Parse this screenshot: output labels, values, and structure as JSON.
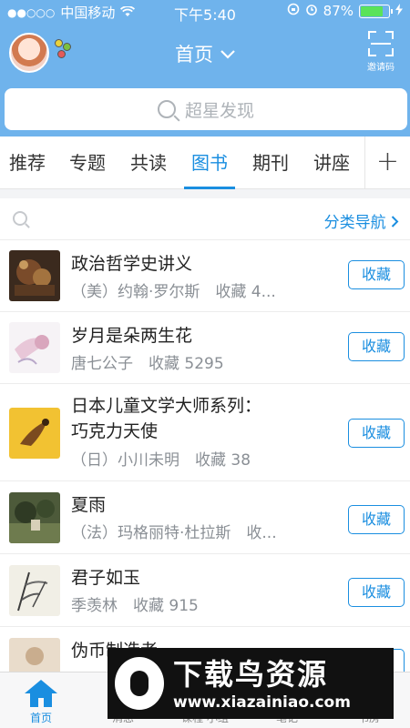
{
  "status_bar": {
    "signal_dots": "●●○○○",
    "carrier": "中国移动",
    "wifi": "wifi-icon",
    "time": "下午5:40",
    "battery_percent": "87%",
    "battery_level": 0.87
  },
  "header": {
    "title": "首页",
    "invite_label": "邀请码"
  },
  "search": {
    "placeholder": "超星发现"
  },
  "tabs": [
    {
      "label": "推荐",
      "active": false
    },
    {
      "label": "专题",
      "active": false
    },
    {
      "label": "共读",
      "active": false
    },
    {
      "label": "图书",
      "active": true
    },
    {
      "label": "期刊",
      "active": false
    },
    {
      "label": "讲座",
      "active": false
    }
  ],
  "add_tab_label": "+",
  "filter": {
    "category_nav": "分类导航"
  },
  "books": [
    {
      "title": "政治哲学史讲义",
      "meta": "（美）约翰·罗尔斯　收藏 4...",
      "button": "收藏"
    },
    {
      "title": "岁月是朵两生花",
      "meta": "唐七公子　收藏 5295",
      "button": "收藏"
    },
    {
      "title": "日本儿童文学大师系列：",
      "title2": "巧克力天使",
      "meta": "（日）小川未明　收藏 38",
      "button": "收藏"
    },
    {
      "title": "夏雨",
      "meta": "（法）玛格丽特·杜拉斯　收...",
      "button": "收藏"
    },
    {
      "title": "君子如玉",
      "meta": "季羡林　收藏 915",
      "button": "收藏"
    },
    {
      "title": "伪币制造者",
      "meta": "",
      "button": "收藏"
    }
  ],
  "bottom_tabs": [
    {
      "label": "首页",
      "active": true
    },
    {
      "label": "消息",
      "active": false
    },
    {
      "label": "课程·小组",
      "active": false
    },
    {
      "label": "笔记",
      "active": false
    },
    {
      "label": "书房",
      "active": false
    }
  ],
  "watermark": {
    "title": "下载鸟资源",
    "url": "www.xiazainiao.com"
  }
}
